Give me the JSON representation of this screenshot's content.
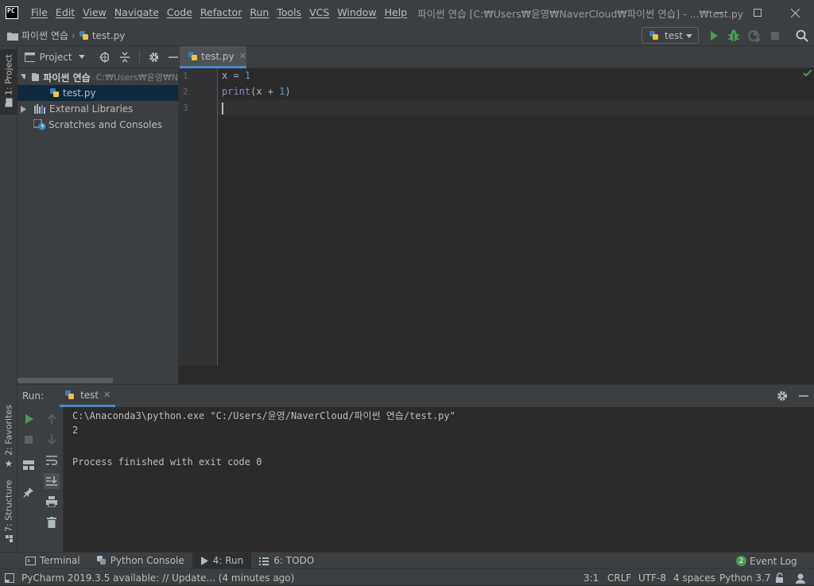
{
  "app": {
    "icon_text": "PC",
    "window_title": "파이썬 연습 [C:₩Users₩윤영₩NaverCloud₩파이썬 연습] - ...₩test.py"
  },
  "menu": [
    "File",
    "Edit",
    "View",
    "Navigate",
    "Code",
    "Refactor",
    "Run",
    "Tools",
    "VCS",
    "Window",
    "Help"
  ],
  "breadcrumb": {
    "project": "파이썬 연습",
    "file": "test.py"
  },
  "run_config": {
    "name": "test"
  },
  "left_tabs": {
    "project": "1: Project",
    "favorites": "2: Favorites",
    "structure": "7: Structure"
  },
  "project_panel": {
    "title": "Project",
    "root": {
      "name": "파이썬 연습",
      "path": "C:₩Users₩윤영₩N"
    },
    "file": "test.py",
    "external": "External Libraries",
    "scratches": "Scratches and Consoles"
  },
  "editor": {
    "tab": "test.py",
    "line_numbers": [
      "1",
      "2",
      "3"
    ],
    "lines": [
      {
        "tokens": [
          {
            "t": "x = ",
            "c": "#a9b7c6"
          },
          {
            "t": "1",
            "c": "#6897bb"
          }
        ]
      },
      {
        "tokens": [
          {
            "t": "print",
            "c": "#8888c6"
          },
          {
            "t": "(x + ",
            "c": "#a9b7c6"
          },
          {
            "t": "1",
            "c": "#6897bb"
          },
          {
            "t": ")",
            "c": "#a9b7c6"
          }
        ]
      },
      {
        "tokens": []
      }
    ]
  },
  "run_panel": {
    "label": "Run:",
    "tab": "test",
    "output": [
      "C:\\Anaconda3\\python.exe \"C:/Users/윤영/NaverCloud/파이썬 연습/test.py\"",
      "2",
      "",
      "Process finished with exit code 0"
    ]
  },
  "bottom_tabs": {
    "terminal": "Terminal",
    "python_console": "Python Console",
    "run": "4: Run",
    "todo": "6: TODO",
    "event_log": "Event Log",
    "event_count": "2"
  },
  "status": {
    "message": "PyCharm 2019.3.5 available: // Update... (4 minutes ago)",
    "position": "3:1",
    "line_sep": "CRLF",
    "encoding": "UTF-8",
    "indent": "4 spaces",
    "interpreter": "Python 3.7"
  },
  "colors": {
    "accent": "#4a88c7",
    "run_green": "#499c54",
    "keyword_builtin": "#8888c6",
    "number": "#6897bb"
  }
}
